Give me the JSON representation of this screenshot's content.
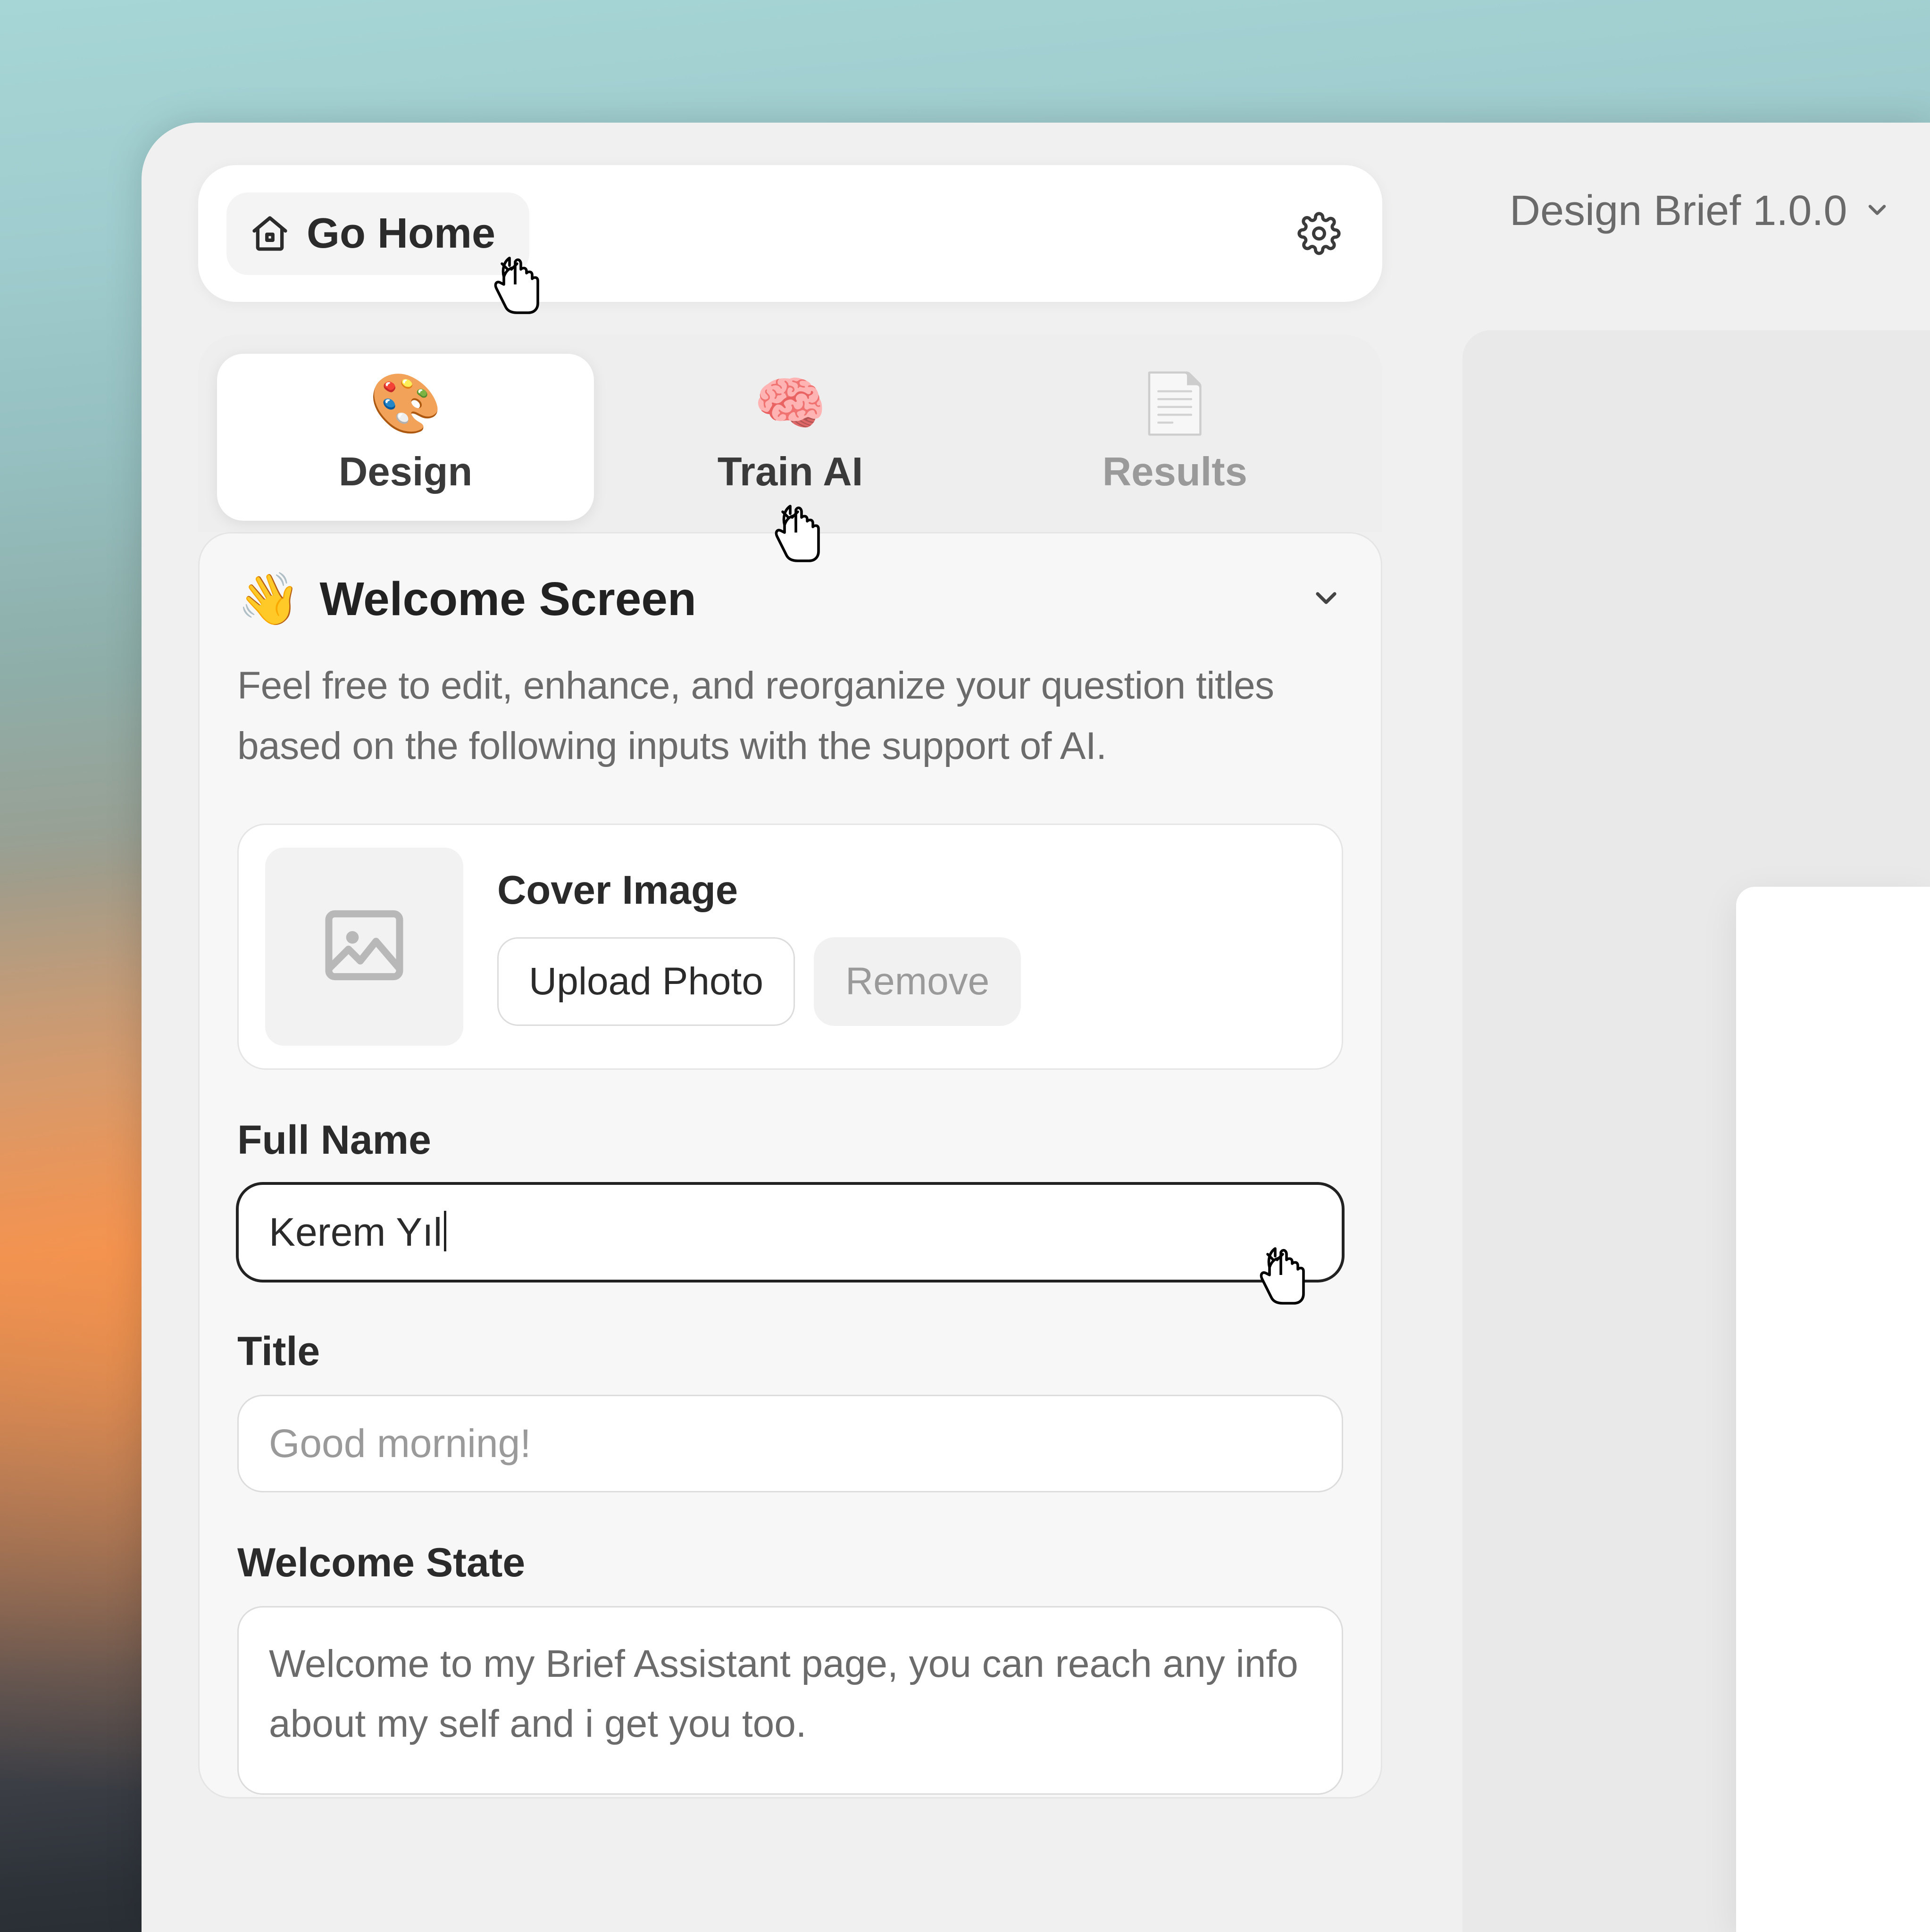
{
  "header": {
    "go_home_label": "Go Home"
  },
  "tabs": {
    "design": "Design",
    "train": "Train AI",
    "results": "Results"
  },
  "section": {
    "emoji": "👋",
    "title": "Welcome Screen",
    "description": "Feel free to edit, enhance, and reorganize your question titles based on the following inputs with the support of AI."
  },
  "cover": {
    "label": "Cover Image",
    "upload_label": "Upload Photo",
    "remove_label": "Remove"
  },
  "form": {
    "full_name_label": "Full Name",
    "full_name_value": "Kerem Yıl",
    "title_label": "Title",
    "title_placeholder": "Good morning!",
    "welcome_state_label": "Welcome State",
    "welcome_state_value": "Welcome to my Brief Assistant page, you can reach any info about my self and i get you too."
  },
  "right": {
    "title": "Design Brief 1.0.0"
  }
}
